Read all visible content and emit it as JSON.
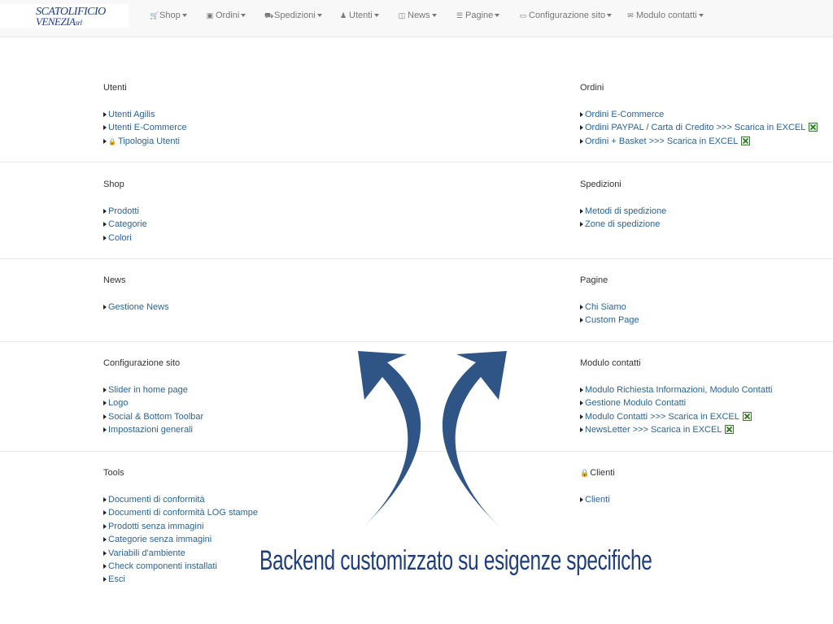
{
  "logo": {
    "line1": "SCATOLIFICIO",
    "line2": "VENEZIA",
    "suffix": "srl"
  },
  "nav": [
    {
      "label": "Shop",
      "icon": "cart-icon"
    },
    {
      "label": "Ordini",
      "icon": "money-icon"
    },
    {
      "label": "Spedizioni",
      "icon": "truck-icon"
    },
    {
      "label": "Utenti",
      "icon": "users-icon"
    },
    {
      "label": "News",
      "icon": "book-icon"
    },
    {
      "label": "Pagine",
      "icon": "list-icon"
    },
    {
      "label": "Configurazione sito",
      "icon": "monitor-icon"
    },
    {
      "label": "Modulo contatti",
      "icon": "envelope-icon"
    }
  ],
  "sections": {
    "utenti": {
      "title": "Utenti",
      "items": [
        "Utenti Agilis",
        "Utenti E-Commerce",
        "Tipologia Utenti"
      ]
    },
    "ordini": {
      "title": "Ordini",
      "items": [
        "Ordini E-Commerce",
        "Ordini PAYPAL / Carta di Credito >>> Scarica in EXCEL",
        "Ordini + Basket >>> Scarica in EXCEL"
      ]
    },
    "shop": {
      "title": "Shop",
      "items": [
        "Prodotti",
        "Categorie",
        "Colori"
      ]
    },
    "spedizioni": {
      "title": "Spedizioni",
      "items": [
        "Metodi di spedizione",
        "Zone di spedizione"
      ]
    },
    "news": {
      "title": "News",
      "items": [
        "Gestione News"
      ]
    },
    "pagine": {
      "title": "Pagine",
      "items": [
        "Chi Siamo",
        "Custom Page"
      ]
    },
    "configurazione": {
      "title": "Configurazione sito",
      "items": [
        "Slider in home page",
        "Logo",
        "Social & Bottom Toolbar",
        "Impostazioni generali"
      ]
    },
    "modulo": {
      "title": "Modulo contatti",
      "items": [
        "Modulo Richiesta Informazioni, Modulo Contatti",
        "Gestione Modulo Contatti",
        "Modulo Contatti >>> Scarica in EXCEL",
        "NewsLetter >>> Scarica in EXCEL"
      ]
    },
    "tools": {
      "title": "Tools",
      "items": [
        "Documenti di conformità",
        "Documenti di conformità LOG stampe",
        "Prodotti senza immagini",
        "Categorie senza immagini",
        "Variabili d'ambiente",
        "Check componenti installati",
        "Esci"
      ]
    },
    "clienti": {
      "title": "Clienti",
      "items": [
        "Clienti"
      ]
    }
  },
  "caption": "Backend customizzato su esigenze specifiche",
  "colors": {
    "link": "#2a6496",
    "caption": "#1f3e7c",
    "arrow": "#2f5486"
  }
}
